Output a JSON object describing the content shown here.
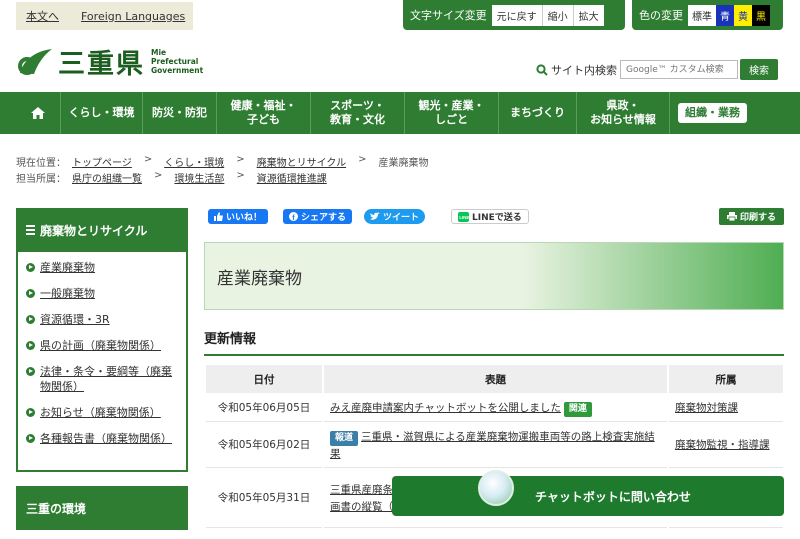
{
  "topbar": {
    "lang_links": [
      "本文へ",
      "Foreign Languages"
    ],
    "fontsize_label": "文字サイズ変更",
    "fontsize_buttons": [
      "元に戻す",
      "縮小",
      "拡大"
    ],
    "color_label": "色の変更",
    "color_buttons": [
      {
        "label": "標準",
        "bg": "#ffffff",
        "fg": "#333333"
      },
      {
        "label": "青",
        "bg": "#1a33b8",
        "fg": "#ffffff"
      },
      {
        "label": "黄",
        "bg": "#ffee00",
        "fg": "#1a33b8"
      },
      {
        "label": "黒",
        "bg": "#000000",
        "fg": "#ffee00"
      }
    ]
  },
  "header": {
    "logo_text": "三重県",
    "logo_en": [
      "Mie",
      "Prefectural",
      "Government"
    ],
    "search_label": "サイト内検索",
    "search_placeholder": "Google™ カスタム検索",
    "search_button": "検索"
  },
  "nav": {
    "items": [
      "くらし・環境",
      "防災・防犯",
      "健康・福祉・\n子ども",
      "スポーツ・\n教育・文化",
      "観光・産業・\nしごと",
      "まちづくり",
      "県政・\nお知らせ情報"
    ],
    "org_button": "組織・業務"
  },
  "breadcrumb": {
    "current_label": "現在位置：",
    "current": [
      "トップページ",
      "くらし・環境",
      "廃棄物とリサイクル",
      "産業廃棄物"
    ],
    "dept_label": "担当所属：",
    "dept": [
      "県庁の組織一覧",
      "環境生活部",
      "資源循環推進課"
    ]
  },
  "sidebar": {
    "title": "廃棄物とリサイクル",
    "items": [
      "産業廃棄物",
      "一般廃棄物",
      "資源循環・3R",
      "県の計画（廃棄物関係）",
      "法律・条令・要綱等（廃棄物関係）",
      "お知らせ（廃棄物関係）",
      "各種報告書（廃棄物関係）"
    ],
    "title2": "三重の環境"
  },
  "share": {
    "like": "いいね！",
    "facebook": "シェアする",
    "tweet": "ツイート",
    "line": "LINEで送る",
    "print": "印刷する"
  },
  "main": {
    "page_title": "産業廃棄物",
    "section_title": "更新情報",
    "table": {
      "headers": [
        "日付",
        "表題",
        "所属"
      ],
      "rows": [
        {
          "date": "令和05年06月05日",
          "badge_before": "",
          "title": "みえ産廃申請案内チャットボットを公開しました",
          "badge_after": "関連",
          "dept": "廃棄物対策課"
        },
        {
          "date": "令和05年06月02日",
          "badge_before": "報道",
          "title": "三重県・滋賀県による産業廃棄物運搬車両等の路上検査実施結果",
          "badge_after": "",
          "dept": "廃棄物監視・指導課"
        },
        {
          "date": "令和05年05月31日",
          "badge_before": "",
          "title": "三重県産廃条例に基づく産業廃棄物の処理施設の設置に関する事業計画書の縦覧（株式会社…内）",
          "badge_after": "",
          "dept": ""
        }
      ]
    }
  },
  "chatbot": {
    "label": "チャットボットに問い合わせ"
  },
  "colors": {
    "primary": "#2e7d32",
    "badge_related": "#2e9a3c",
    "badge_press": "#3a7fa8"
  }
}
